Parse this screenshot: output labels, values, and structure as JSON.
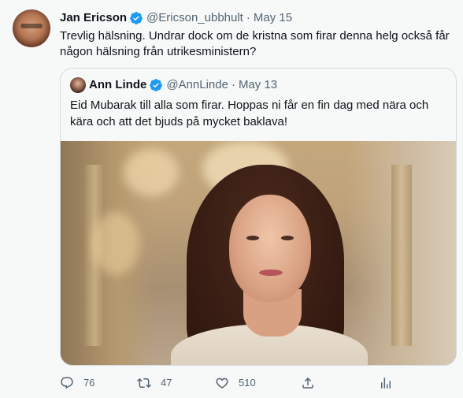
{
  "tweet": {
    "author_name": "Jan Ericson",
    "author_handle": "@Ericson_ubbhult",
    "separator": "·",
    "date": "May 15",
    "text": "Trevlig hälsning. Undrar dock om de kristna som firar denna helg också får någon hälsning från utrikesministern?",
    "verified_icon": "verified-badge-icon"
  },
  "quoted_tweet": {
    "author_name": "Ann Linde",
    "author_handle": "@AnnLinde",
    "separator": "·",
    "date": "May 13",
    "text": "Eid Mubarak till alla som firar. Hoppas ni får en fin dag med nära och kära och att det bjuds på mycket baklava!",
    "image_icon": "photo-of-woman-in-ornate-hall"
  },
  "actions": {
    "reply_count": "76",
    "retweet_count": "47",
    "like_count": "510"
  },
  "colors": {
    "background": "#f7f9f9",
    "text": "#0f1419",
    "muted": "#536471",
    "verified": "#1d9bf0",
    "border": "#cfd9de"
  }
}
